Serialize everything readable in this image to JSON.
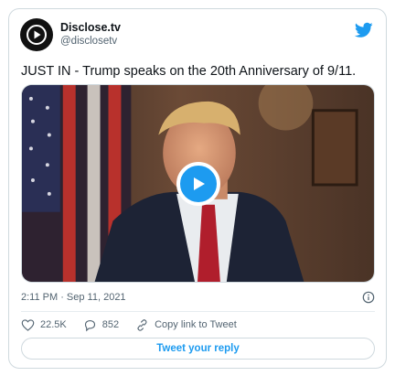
{
  "author": {
    "name": "Disclose.tv",
    "handle": "@disclosetv",
    "avatar_icon": "play-triangle-logo"
  },
  "platform_icon": "twitter-bird-icon",
  "tweet": {
    "text": "JUST IN - Trump speaks on the 20th Anniversary of 9/11."
  },
  "media": {
    "type": "video",
    "play_icon": "play-icon"
  },
  "meta": {
    "timestamp": "2:11 PM · Sep 11, 2021",
    "info_icon": "info-icon"
  },
  "actions": {
    "likes": "22.5K",
    "replies": "852",
    "copy_link_label": "Copy link to Tweet"
  },
  "reply_button_label": "Tweet your reply",
  "colors": {
    "accent": "#1d9bf0",
    "text": "#0f1419",
    "muted": "#536471",
    "border": "#cfd9de"
  }
}
